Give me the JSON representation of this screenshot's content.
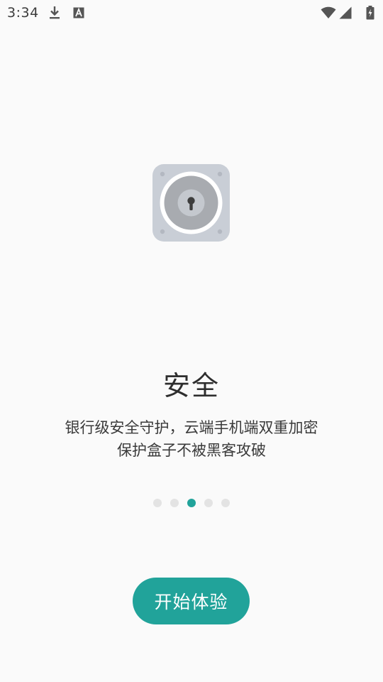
{
  "status_bar": {
    "time": "3:34",
    "icons": [
      "download-icon",
      "a-text-icon",
      "wifi-icon",
      "signal-icon",
      "battery-charging-icon"
    ]
  },
  "onboarding": {
    "illustration": "safe-lock-icon",
    "title": "安全",
    "description_lines": [
      "银行级安全守护，云端手机端双重加密",
      "保护盒子不被黑客攻破"
    ],
    "page_count": 5,
    "active_page": 3
  },
  "start_button": {
    "label": "开始体验"
  },
  "colors": {
    "accent": "#21a39a",
    "dot_inactive": "#e3e3e3",
    "background": "#fafafa",
    "lock_body": "#c9ced6"
  }
}
